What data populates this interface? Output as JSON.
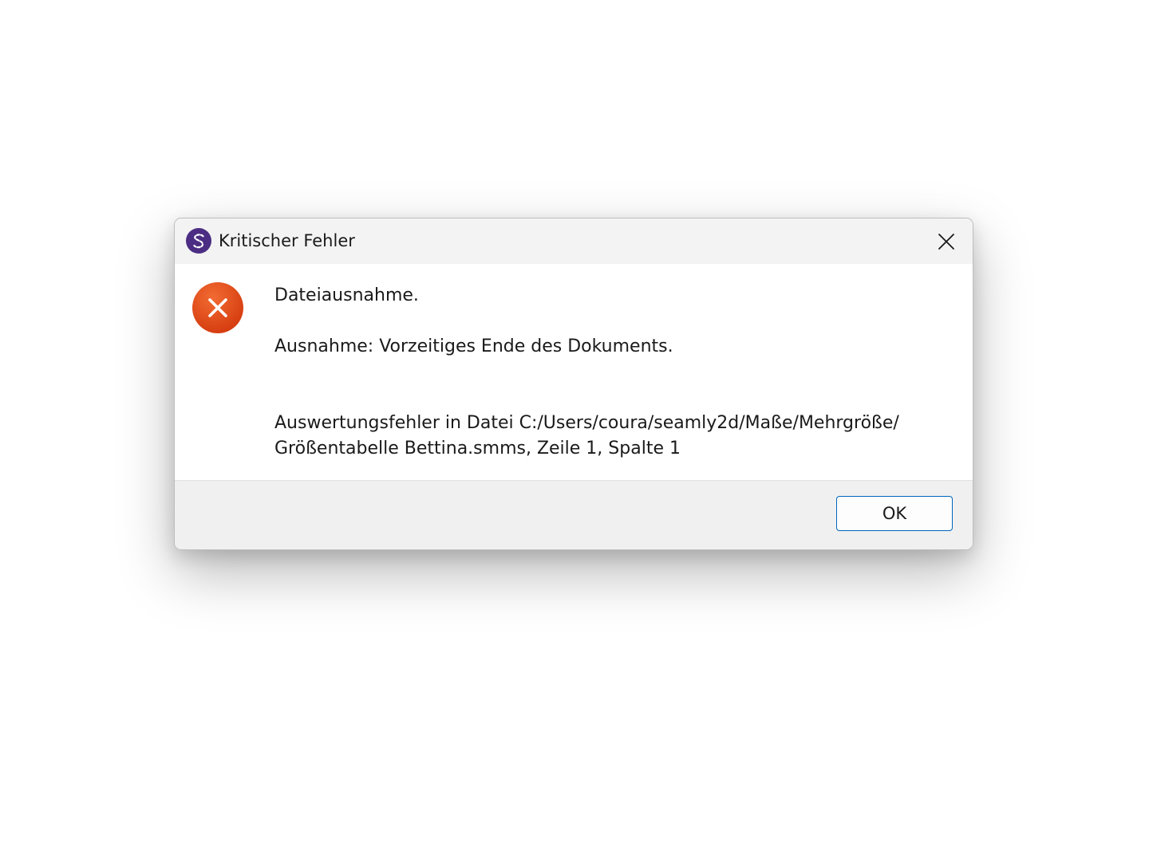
{
  "window": {
    "title": "Kritischer Fehler",
    "app_icon": "seamly-logo-icon",
    "close_icon": "close-icon"
  },
  "message": {
    "icon": "error-icon",
    "line1": "Dateiausnahme.",
    "line2": "Ausnahme: Vorzeitiges Ende des Dokuments.",
    "line3": "Auswertungsfehler in Datei C:/Users/coura/seamly2d/Maße/Mehrgröße/",
    "line4": "Größentabelle Bettina.smms, Zeile 1, Spalte 1"
  },
  "buttons": {
    "ok_label": "OK"
  },
  "colors": {
    "error_red": "#e0471a",
    "app_purple": "#4b2e83",
    "button_border": "#0067c0"
  }
}
